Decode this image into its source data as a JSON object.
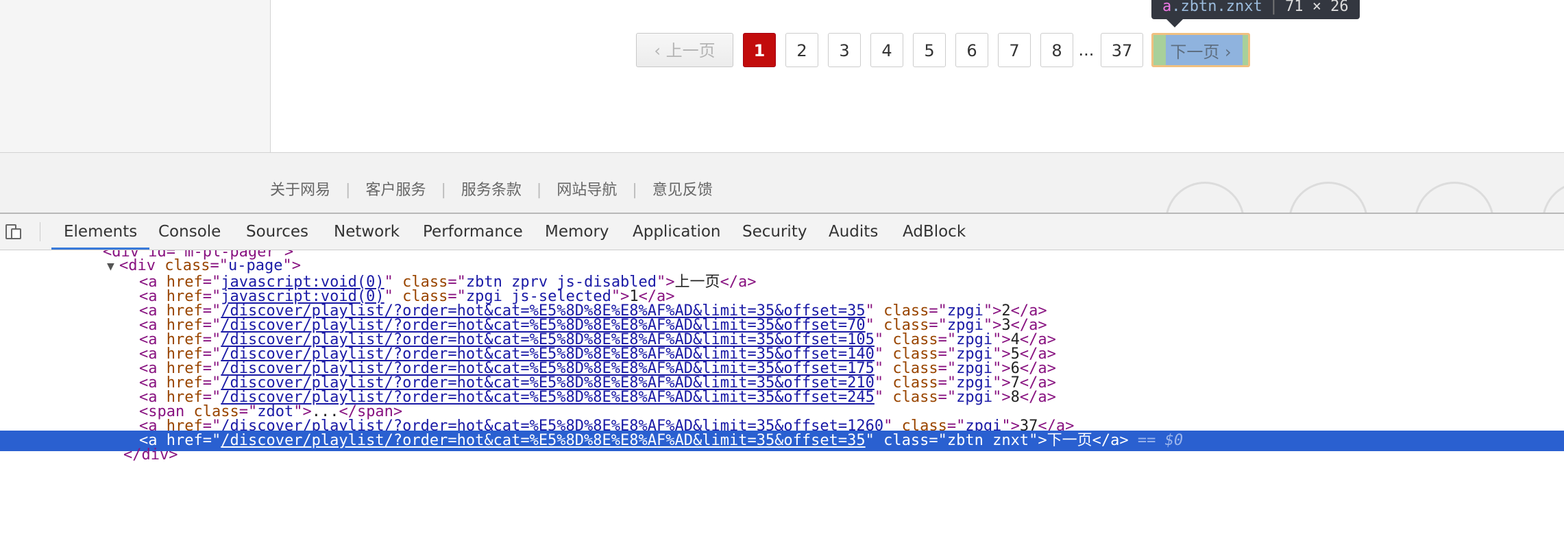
{
  "pager": {
    "prev_label": "上一页",
    "active_page": "1",
    "pages": [
      "2",
      "3",
      "4",
      "5",
      "6",
      "7",
      "8"
    ],
    "dots": "...",
    "last_page": "37",
    "next_label": "下一页"
  },
  "tooltip": {
    "tag": "a",
    "classes": ".zbtn.znxt",
    "size": "71 × 26"
  },
  "footer": {
    "links": [
      "关于网易",
      "客户服务",
      "服务条款",
      "网站导航",
      "意见反馈"
    ],
    "separator": "|"
  },
  "devtools": {
    "tabs": [
      "Elements",
      "Console",
      "Sources",
      "Network",
      "Performance",
      "Memory",
      "Application",
      "Security",
      "Audits",
      "AdBlock"
    ],
    "active_tab": "Elements",
    "code": {
      "top_partial": "<div id=\"m-pl-pager\">",
      "u_page_open": {
        "tag": "div",
        "attr": "class",
        "value": "u-page"
      },
      "rows": [
        {
          "href": "javascript:void(0)",
          "cls": "zbtn zprv js-disabled",
          "text": "上一页"
        },
        {
          "href": "javascript:void(0)",
          "cls": "zpgi js-selected",
          "text": "1"
        },
        {
          "href": "/discover/playlist/?order=hot&cat=%E5%8D%8E%E8%AF%AD&limit=35&offset=35",
          "cls": "zpgi",
          "text": "2"
        },
        {
          "href": "/discover/playlist/?order=hot&cat=%E5%8D%8E%E8%AF%AD&limit=35&offset=70",
          "cls": "zpgi",
          "text": "3"
        },
        {
          "href": "/discover/playlist/?order=hot&cat=%E5%8D%8E%E8%AF%AD&limit=35&offset=105",
          "cls": "zpgi",
          "text": "4"
        },
        {
          "href": "/discover/playlist/?order=hot&cat=%E5%8D%8E%E8%AF%AD&limit=35&offset=140",
          "cls": "zpgi",
          "text": "5"
        },
        {
          "href": "/discover/playlist/?order=hot&cat=%E5%8D%8E%E8%AF%AD&limit=35&offset=175",
          "cls": "zpgi",
          "text": "6"
        },
        {
          "href": "/discover/playlist/?order=hot&cat=%E5%8D%8E%E8%AF%AD&limit=35&offset=210",
          "cls": "zpgi",
          "text": "7"
        },
        {
          "href": "/discover/playlist/?order=hot&cat=%E5%8D%8E%E8%AF%AD&limit=35&offset=245",
          "cls": "zpgi",
          "text": "8"
        }
      ],
      "span_row": {
        "cls": "zdot",
        "text": "..."
      },
      "last_row": {
        "href": "/discover/playlist/?order=hot&cat=%E5%8D%8E%E8%AF%AD&limit=35&offset=1260",
        "cls": "zpgi",
        "text": "37"
      },
      "selected_row": {
        "href": "/discover/playlist/?order=hot&cat=%E5%8D%8E%E8%AF%AD&limit=35&offset=35",
        "cls": "zbtn znxt",
        "text": "下一页",
        "console_ref": "== $0"
      },
      "close_div": "</div>"
    }
  },
  "colors": {
    "active_page_bg": "#c20c0c",
    "selection_bg": "#2a60d0",
    "tab_underline": "#3879d9",
    "tag": "#881280",
    "attr_name": "#994500",
    "attr_value": "#1a1aa6"
  }
}
